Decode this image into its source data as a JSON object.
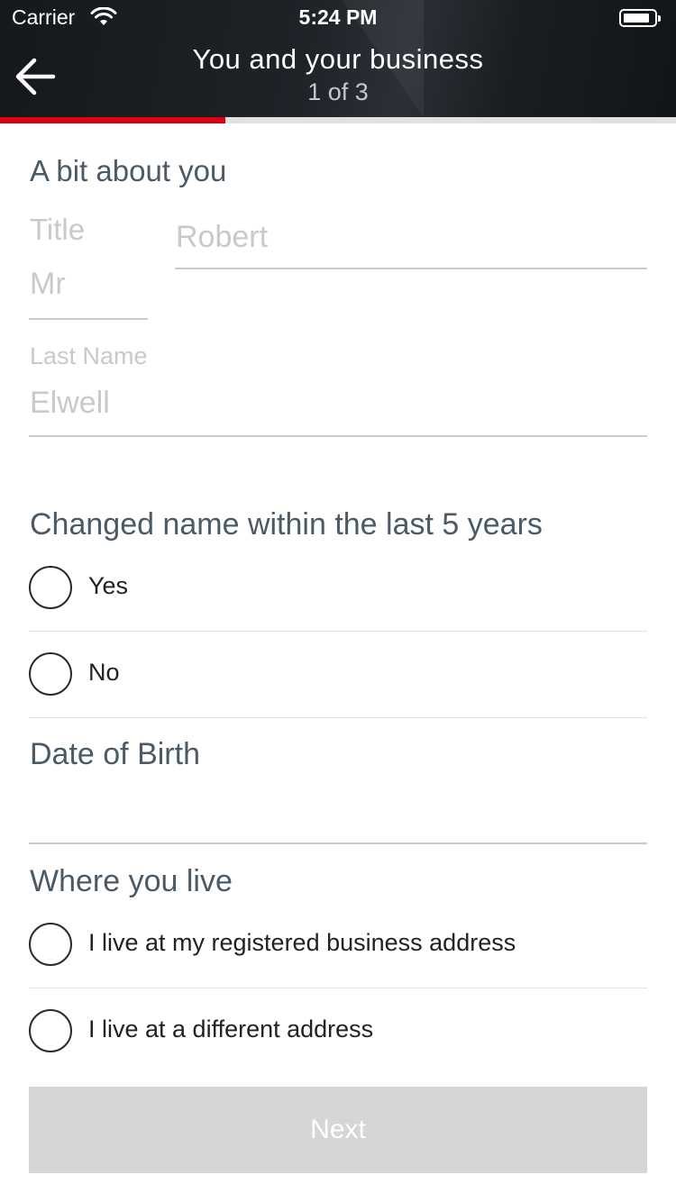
{
  "status_bar": {
    "carrier": "Carrier",
    "time": "5:24 PM"
  },
  "header": {
    "title": "You and your business",
    "step": "1 of 3"
  },
  "progress": {
    "fraction": 0.3333,
    "color": "#db0011"
  },
  "about": {
    "section_title": "A bit about you",
    "title_label": "Title",
    "title_value": "Mr",
    "first_name_value": "Robert",
    "last_name_label": "Last Name",
    "last_name_value": "Elwell"
  },
  "changed_name": {
    "question": "Changed name within the last 5 years",
    "options": [
      "Yes",
      "No"
    ]
  },
  "dob": {
    "label": "Date of Birth",
    "value": ""
  },
  "residence": {
    "section_title": "Where you live",
    "options": [
      "I live at my registered business address",
      "I live at a different address"
    ]
  },
  "next_button": {
    "label": "Next"
  },
  "icons": {
    "back": "arrow-left-icon",
    "wifi": "wifi-icon",
    "battery": "battery-icon",
    "radio": "radio-unchecked-icon"
  }
}
